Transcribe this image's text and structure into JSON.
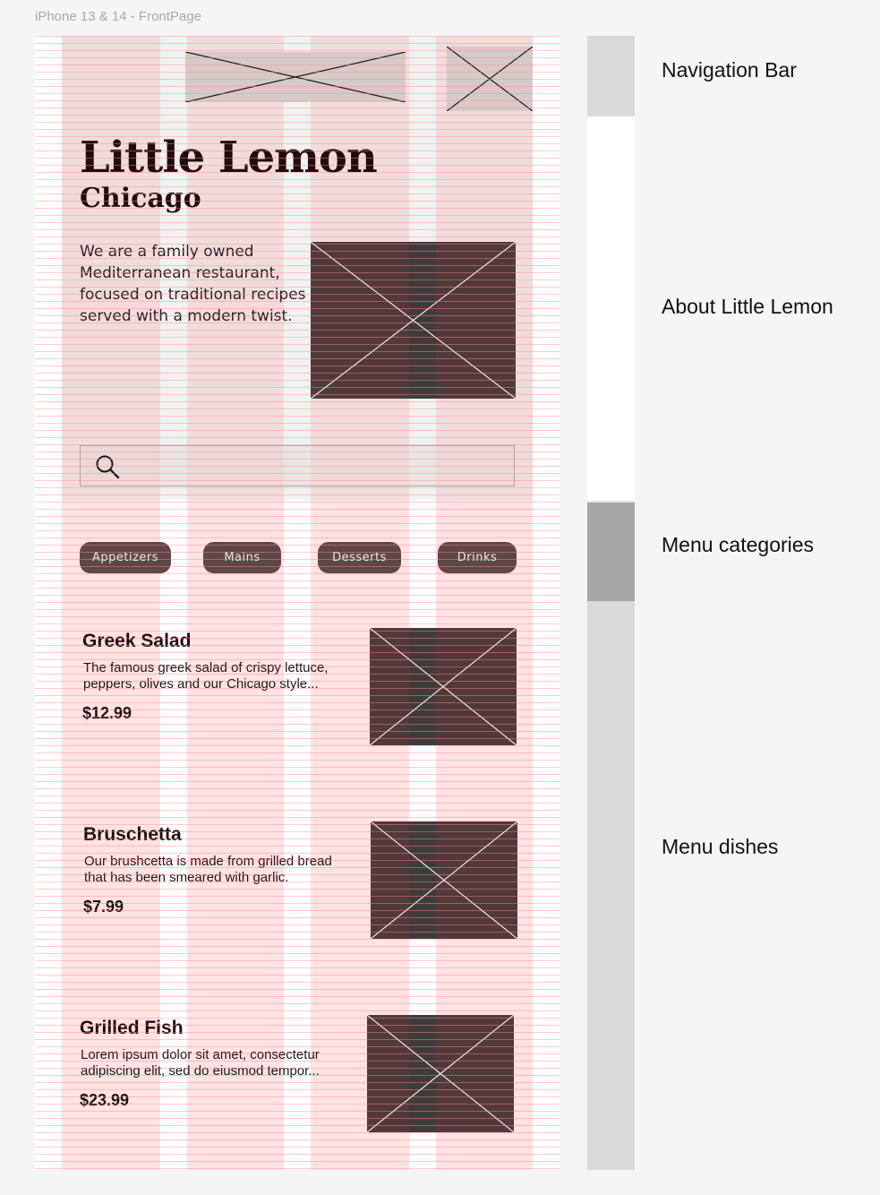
{
  "frame": {
    "label": "iPhone 13 & 14 - FrontPage"
  },
  "hero": {
    "title": "Little Lemon",
    "subtitle": "Chicago",
    "description": "We are a family owned Mediterranean restaurant, focused on traditional recipes served with a modern twist."
  },
  "search": {
    "icon": "search-icon"
  },
  "categories": [
    "Appetizers",
    "Mains",
    "Desserts",
    "Drinks"
  ],
  "dishes": [
    {
      "name": "Greek Salad",
      "description": "The famous greek salad of crispy lettuce, peppers, olives and our Chicago style...",
      "price": "$12.99"
    },
    {
      "name": "Bruschetta",
      "description": "Our brushcetta is made from grilled bread that has been smeared with garlic.",
      "price": "$7.99"
    },
    {
      "name": "Grilled Fish",
      "description": "Lorem ipsum dolor sit amet, consectetur adipiscing elit, sed do eiusmod tempor...",
      "price": "$23.99"
    }
  ],
  "annotations": [
    "Navigation Bar",
    "About Little Lemon",
    "Menu categories",
    "Menu dishes"
  ],
  "colors": {
    "primary_dark": "#52393a",
    "chip": "#5e4747",
    "title_text": "#230c0c",
    "grid_overlay": "#ffa0a0"
  }
}
